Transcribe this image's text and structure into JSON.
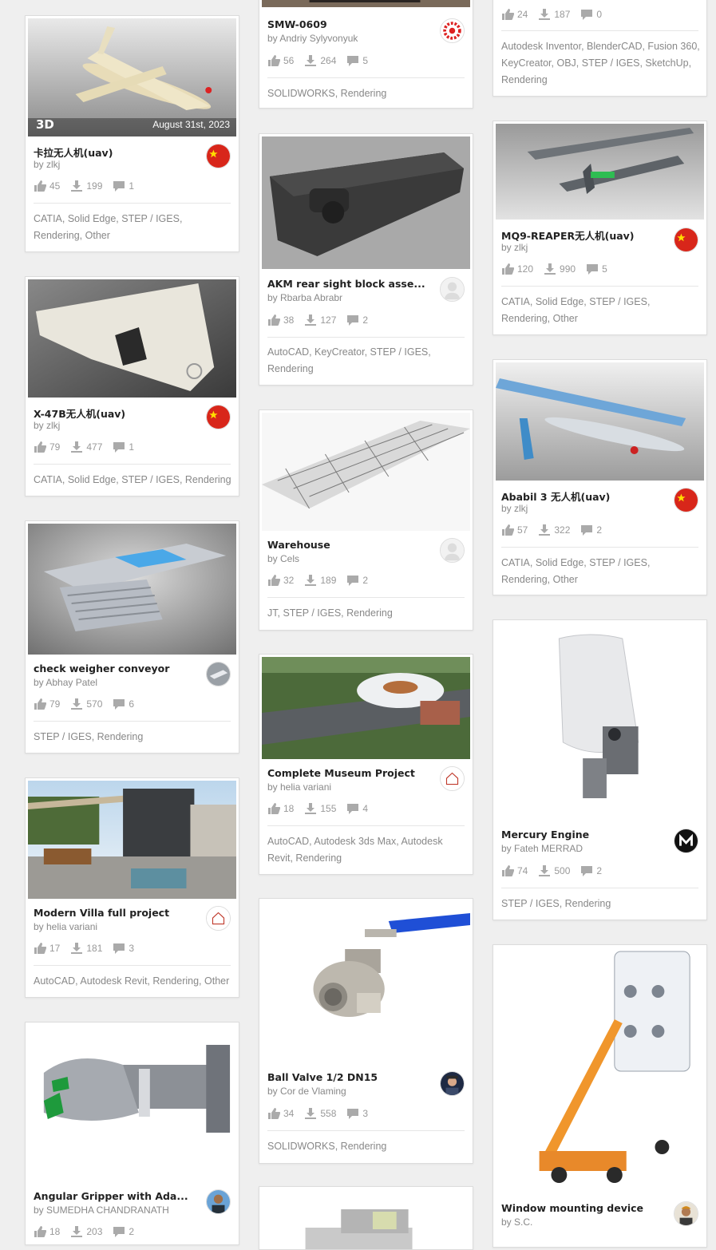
{
  "colors": {
    "background": "#efefef",
    "card": "#ffffff",
    "muted": "#888888",
    "title": "#222222"
  },
  "cards": [
    {
      "title": "卡拉无人机(uav)",
      "author": "by zlkj",
      "likes": "45",
      "downloads": "199",
      "comments": "1",
      "tags": "CATIA, Solid Edge, STEP / IGES, Rendering, Other",
      "badge": "3D",
      "date": "August 31st, 2023",
      "avatar": "china-flag-avatar"
    },
    {
      "title": "X-47B无人机(uav)",
      "author": "by zlkj",
      "likes": "79",
      "downloads": "477",
      "comments": "1",
      "tags": "CATIA, Solid Edge, STEP / IGES, Rendering",
      "avatar": "china-flag-avatar"
    },
    {
      "title": "check weigher conveyor",
      "author": "by Abhay Patel",
      "likes": "79",
      "downloads": "570",
      "comments": "6",
      "tags": "STEP / IGES, Rendering",
      "avatar": "conveyor-avatar"
    },
    {
      "title": "Modern Villa full project",
      "author": "by helia variani",
      "likes": "17",
      "downloads": "181",
      "comments": "3",
      "tags": "AutoCAD, Autodesk Revit, Rendering, Other",
      "avatar": "house-logo-avatar"
    },
    {
      "title": "Angular Gripper with Ada...",
      "author": "by SUMEDHA CHANDRANATH",
      "likes": "18",
      "downloads": "203",
      "comments": "2",
      "avatar": "person-avatar"
    },
    {
      "title": "SMW-0609",
      "author": "by Andriy Sylyvonyuk",
      "likes": "56",
      "downloads": "264",
      "comments": "5",
      "tags": "SOLIDWORKS, Rendering",
      "avatar": "gear-logo-avatar"
    },
    {
      "title": "AKM rear sight block asse...",
      "author": "by Rbarba Abrabr",
      "likes": "38",
      "downloads": "127",
      "comments": "2",
      "tags": "AutoCAD, KeyCreator, STEP / IGES, Rendering",
      "avatar": "default-user-avatar"
    },
    {
      "title": "Warehouse",
      "author": "by Cels",
      "likes": "32",
      "downloads": "189",
      "comments": "2",
      "tags": "JT, STEP / IGES, Rendering",
      "avatar": "default-user-avatar"
    },
    {
      "title": "Complete Museum Project",
      "author": "by helia variani",
      "likes": "18",
      "downloads": "155",
      "comments": "4",
      "tags": "AutoCAD, Autodesk 3ds Max, Autodesk Revit, Rendering",
      "avatar": "house-logo-avatar"
    },
    {
      "title": "Ball Valve 1/2 DN15",
      "author": "by Cor de Vlaming",
      "likes": "34",
      "downloads": "558",
      "comments": "3",
      "tags": "SOLIDWORKS, Rendering",
      "avatar": "person-avatar"
    },
    {
      "likes": "24",
      "downloads": "187",
      "comments": "0",
      "tags": "Autodesk Inventor, BlenderCAD, Fusion 360, KeyCreator, OBJ, STEP / IGES, SketchUp, Rendering"
    },
    {
      "title": "MQ9-REAPER无人机(uav)",
      "author": "by zlkj",
      "likes": "120",
      "downloads": "990",
      "comments": "5",
      "tags": "CATIA, Solid Edge, STEP / IGES, Rendering, Other",
      "avatar": "china-flag-avatar"
    },
    {
      "title": "Ababil 3 无人机(uav)",
      "author": "by zlkj",
      "likes": "57",
      "downloads": "322",
      "comments": "2",
      "tags": "CATIA, Solid Edge, STEP / IGES, Rendering, Other",
      "avatar": "china-flag-avatar"
    },
    {
      "title": "Mercury Engine",
      "author": "by Fateh MERRAD",
      "likes": "74",
      "downloads": "500",
      "comments": "2",
      "tags": "STEP / IGES, Rendering",
      "avatar": "m-logo-avatar"
    },
    {
      "title": "Window mounting device",
      "author": "by S.C.",
      "avatar": "person-avatar"
    }
  ]
}
